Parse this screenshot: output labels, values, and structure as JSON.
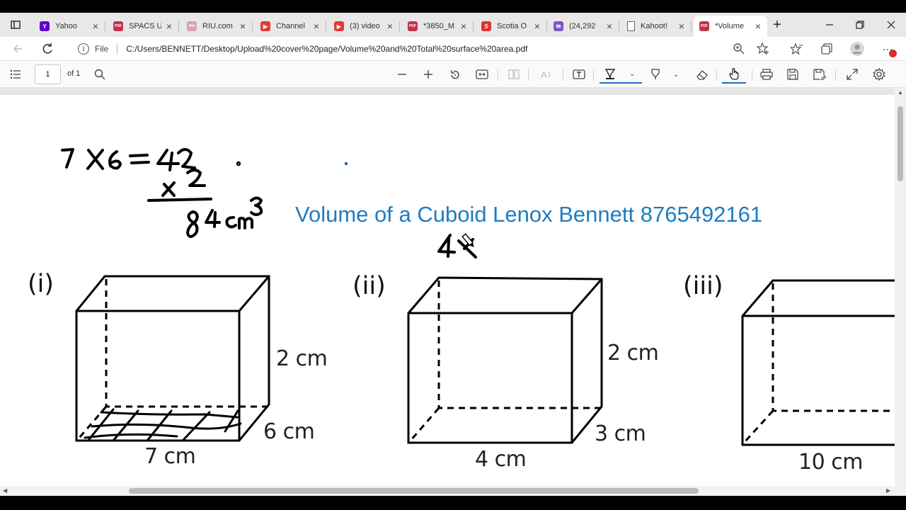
{
  "tabs": [
    {
      "label": "Yahoo",
      "icon": "yahoo-icon",
      "color": "#6001d2",
      "glyph": "Y"
    },
    {
      "label": "SPACS U",
      "icon": "pdf-icon",
      "color": "#c4314b",
      "glyph": "PDF"
    },
    {
      "label": "RIU.com",
      "icon": "riu-icon",
      "color": "#d9a3a8",
      "glyph": "RIU"
    },
    {
      "label": "Channel",
      "icon": "youtube-icon",
      "color": "#e53935",
      "glyph": "▶"
    },
    {
      "label": "(3) video",
      "icon": "youtube-icon",
      "color": "#e53935",
      "glyph": "▶"
    },
    {
      "label": "*3850_M",
      "icon": "pdf-icon",
      "color": "#c4314b",
      "glyph": "PDF"
    },
    {
      "label": "Scotia O",
      "icon": "scotia-icon",
      "color": "#d33",
      "glyph": "S"
    },
    {
      "label": "(24,292",
      "icon": "mail-icon",
      "color": "#7e57c2",
      "glyph": "✉"
    },
    {
      "label": "Kahoot!",
      "icon": "page-icon",
      "color": "#ffffff",
      "glyph": ""
    },
    {
      "label": "*Volume",
      "icon": "pdf-icon",
      "color": "#c4314b",
      "glyph": "PDF"
    }
  ],
  "address": {
    "file_label": "File",
    "url": "C:/Users/BENNETT/Desktop/Upload%20cover%20page/Volume%20and%20Total%20surface%20area.pdf"
  },
  "toolbar": {
    "page_number": "1",
    "page_total": "of 1"
  },
  "document": {
    "title": "Volume of a Cuboid Lenox Bennett 8765492161",
    "figures": [
      {
        "label": "(i)",
        "height": "2 cm",
        "depth": "6 cm",
        "width": "7 cm"
      },
      {
        "label": "(ii)",
        "height": "2 cm",
        "depth": "3 cm",
        "width": "4 cm"
      },
      {
        "label": "(iii)",
        "width": "10 cm"
      }
    ]
  },
  "colors": {
    "accent": "#1a6fbf",
    "title": "#1f7cc0"
  }
}
